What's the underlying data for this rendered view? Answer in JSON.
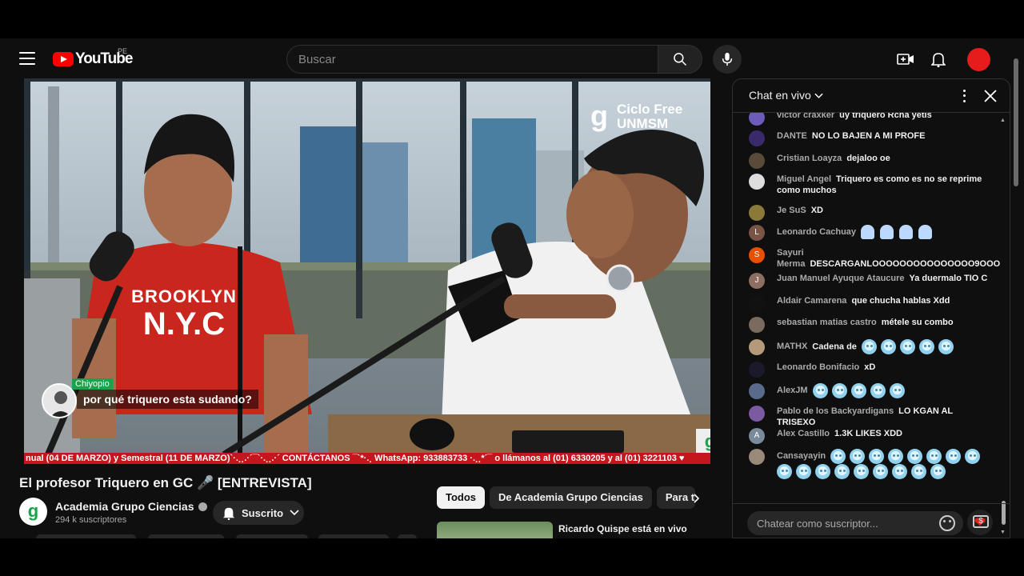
{
  "header": {
    "logo_text": "YouTube",
    "region": "PE",
    "search_placeholder": "Buscar"
  },
  "video": {
    "ticker": "nual (04 DE MARZO) y Semestral (11 DE MARZO)`·.¸¸.·´¯`·.¸¸.·´ CONTÁCTANOS ¯`*·.¸ WhatsApp: 933883733 ·.¸¸*´¯ o llámanos al (01) 6330205 y al (01) 3221103 ♥",
    "watermark_logo": "g",
    "watermark_line1": "Ciclo Free",
    "watermark_line2": "UNMSM",
    "overlay_name": "Chiyopio",
    "overlay_text": "por qué triquero esta sudando?",
    "corner_logo": "g",
    "shirt_text_1": "BROOKLYN",
    "shirt_text_2": "N.Y.C",
    "title": "El profesor Triquero en GC 🎤 [ENTREVISTA]"
  },
  "channel": {
    "avatar_letter": "g",
    "name": "Academia Grupo Ciencias",
    "subscribers": "294 k suscriptores",
    "subscribe_label": "Suscrito"
  },
  "chips": [
    "Todos",
    "De Academia Grupo Ciencias",
    "Para ti"
  ],
  "recommendation": {
    "title": "Ricardo Quispe está en vivo"
  },
  "chat": {
    "title": "Chat en vivo",
    "input_placeholder": "Chatear como suscriptor...",
    "messages": [
      {
        "author": "victor craxker",
        "text": "uy triquero Rcha yetis",
        "avatar_color": "#6c5bb8",
        "avatar_letter": ""
      },
      {
        "author": "DANTE",
        "text": "NO LO BAJEN A MI PROFE",
        "avatar_color": "#3b2a6b",
        "avatar_letter": ""
      },
      {
        "author": "Cristian Loayza",
        "text": "dejaloo oe",
        "avatar_color": "#5a4a3a",
        "avatar_letter": ""
      },
      {
        "author": "Miguel Angel",
        "text": "Triquero es como es no se reprime como muchos",
        "avatar_color": "#dddddd",
        "avatar_letter": ""
      },
      {
        "author": "Je SuS",
        "text": "XD",
        "avatar_color": "#8a7a3a",
        "avatar_letter": ""
      },
      {
        "author": "Leonardo Cachuay",
        "text": "",
        "avatar_color": "#795548",
        "avatar_letter": "L",
        "emoji": "ghost",
        "emoji_count": 4
      },
      {
        "author": "Sayuri Merma",
        "text": "DESCARGANLOOOOOOOOOOOOOOO9OOO",
        "avatar_color": "#e65100",
        "avatar_letter": "S"
      },
      {
        "author": "Juan Manuel Ayuque Ataucure",
        "text": "Ya duermalo TIO C",
        "avatar_color": "#8d6e63",
        "avatar_letter": "J"
      },
      {
        "author": "Aldair Camarena",
        "text": "que chucha hablas Xdd",
        "avatar_color": "#111111",
        "avatar_letter": ""
      },
      {
        "author": "sebastian matias castro",
        "text": "métele su combo",
        "avatar_color": "#7a6a60",
        "avatar_letter": ""
      },
      {
        "author": "MATHX",
        "text": "Cadena de",
        "avatar_color": "#b49a7a",
        "avatar_letter": "",
        "emoji": "frost",
        "emoji_count": 5
      },
      {
        "author": "Leonardo Bonifacio",
        "text": "xD",
        "avatar_color": "#1a1a2a",
        "avatar_letter": ""
      },
      {
        "author": "AlexJM",
        "text": "",
        "avatar_color": "#5a6a8a",
        "avatar_letter": "",
        "emoji": "frost",
        "emoji_count": 5
      },
      {
        "author": "Pablo de los Backyardigans",
        "text": "LO KGAN AL TRISEXO",
        "avatar_color": "#7a5aa0",
        "avatar_letter": ""
      },
      {
        "author": "Alex Castillo",
        "text": "1.3K LIKES XDD",
        "avatar_color": "#7a8a9a",
        "avatar_letter": "A"
      },
      {
        "author": "Cansayayin",
        "text": "",
        "avatar_color": "#9a8a7a",
        "avatar_letter": "",
        "emoji": "frost",
        "emoji_count": 17
      }
    ]
  }
}
